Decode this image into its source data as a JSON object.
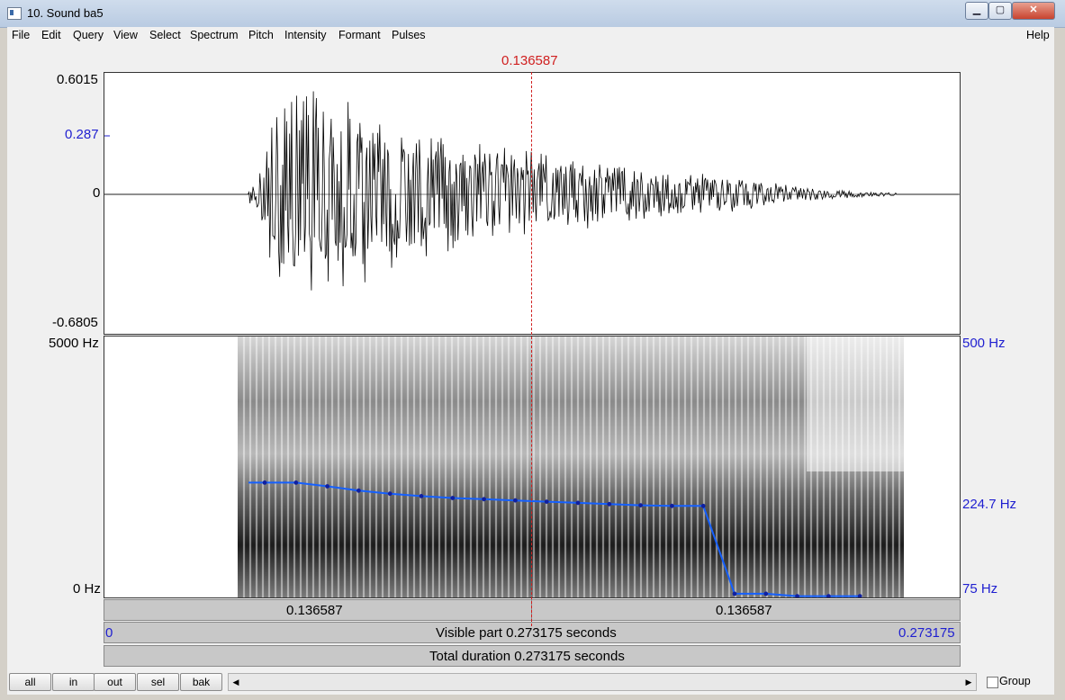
{
  "window": {
    "title": "10. Sound ba5",
    "minimize": "▁",
    "maximize": "▢",
    "close": "✕"
  },
  "menu": {
    "left": [
      "File",
      "Edit",
      "Query",
      "View",
      "Select",
      "Spectrum",
      "Pitch",
      "Intensity",
      "Formant",
      "Pulses"
    ],
    "right": "Help"
  },
  "cursor": {
    "time_label": "0.136587"
  },
  "waveform": {
    "ymax": "0.6015",
    "ycursor": "0.287",
    "yzero": "0",
    "ymin": "-0.6805"
  },
  "spectrogram": {
    "fmax": "5000 Hz",
    "fmin": "0 Hz"
  },
  "pitch": {
    "max": "500 Hz",
    "cursor_value": "224.7 Hz",
    "min": "75 Hz",
    "points_hz": [
      262,
      262,
      256,
      249,
      244,
      240,
      237,
      235,
      233,
      231,
      229,
      227,
      225,
      224,
      224,
      81,
      81,
      77,
      77,
      77
    ]
  },
  "time_bars": {
    "left_segment": "0.136587",
    "right_segment": "0.136587",
    "start": "0",
    "end": "0.273175",
    "visible": "Visible part 0.273175 seconds",
    "total": "Total duration 0.273175 seconds"
  },
  "buttons": {
    "all": "all",
    "in": "in",
    "out": "out",
    "sel": "sel",
    "bak": "bak"
  },
  "group": {
    "label": "Group"
  },
  "colors": {
    "pitch": "#1560ff",
    "cursor": "#d02020",
    "axis_blue": "#1f1fd0"
  }
}
